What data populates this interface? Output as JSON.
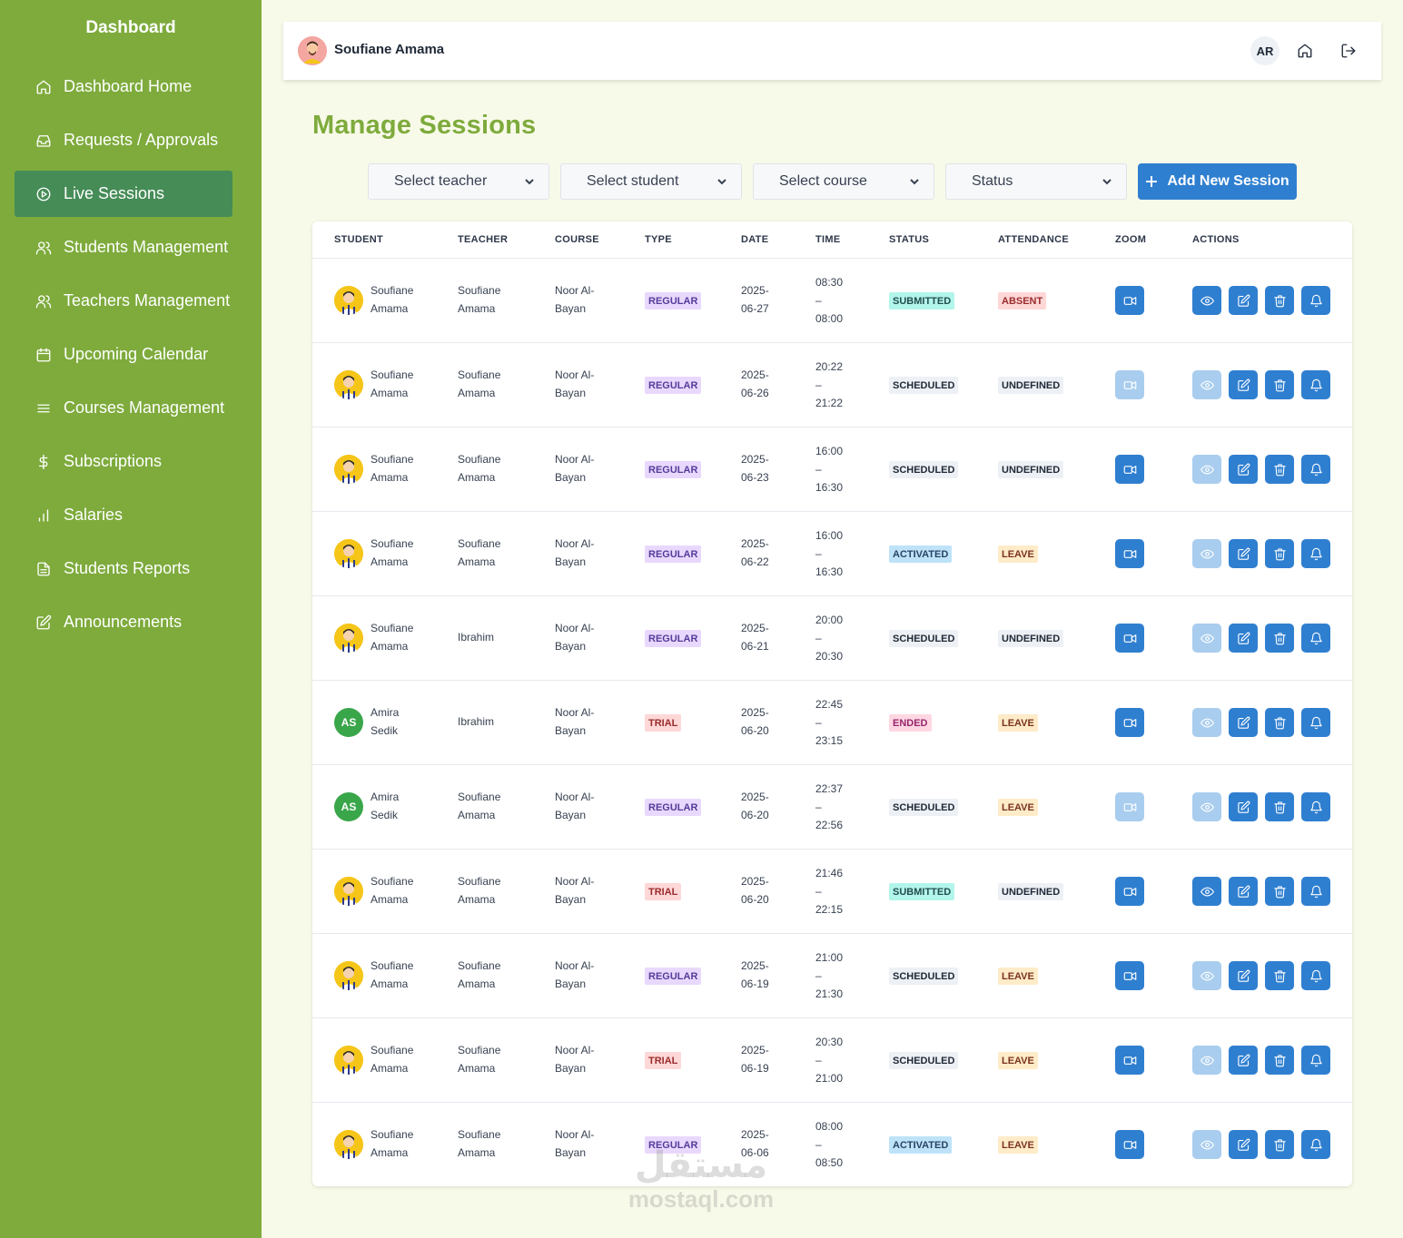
{
  "sidebar": {
    "title": "Dashboard",
    "items": [
      {
        "label": "Dashboard Home",
        "icon": "home-icon",
        "active": false
      },
      {
        "label": "Requests / Approvals",
        "icon": "inbox-icon",
        "active": false
      },
      {
        "label": "Live Sessions",
        "icon": "play-circle-icon",
        "active": true
      },
      {
        "label": "Students Management",
        "icon": "users-icon",
        "active": false
      },
      {
        "label": "Teachers Management",
        "icon": "users-icon",
        "active": false
      },
      {
        "label": "Upcoming Calendar",
        "icon": "calendar-icon",
        "active": false
      },
      {
        "label": "Courses Management",
        "icon": "list-icon",
        "active": false
      },
      {
        "label": "Subscriptions",
        "icon": "dollar-icon",
        "active": false
      },
      {
        "label": "Salaries",
        "icon": "bar-chart-icon",
        "active": false
      },
      {
        "label": "Students Reports",
        "icon": "file-text-icon",
        "active": false
      },
      {
        "label": "Announcements",
        "icon": "edit-icon",
        "active": false
      }
    ]
  },
  "header": {
    "user_name": "Soufiane Amama",
    "language": "AR",
    "home_icon": "home-icon",
    "logout_icon": "logout-icon"
  },
  "page": {
    "title": "Manage Sessions"
  },
  "filters": {
    "teacher": "Select teacher",
    "student": "Select student",
    "course": "Select course",
    "status": "Status",
    "add_button": "Add New Session"
  },
  "table": {
    "columns": [
      "STUDENT",
      "TEACHER",
      "COURSE",
      "TYPE",
      "DATE",
      "TIME",
      "STATUS",
      "ATTENDANCE",
      "ZOOM",
      "ACTIONS"
    ],
    "rows": [
      {
        "avatar": "pic",
        "initials": "",
        "student": [
          "Soufiane",
          "Amama"
        ],
        "teacher": [
          "Soufiane",
          "Amama"
        ],
        "course": [
          "Noor Al-",
          "Bayan"
        ],
        "type": "REGULAR",
        "date": [
          "2025-",
          "06-27"
        ],
        "time": [
          "08:30",
          "–",
          "08:00"
        ],
        "status": "SUBMITTED",
        "attendance": "ABSENT",
        "zoom_enabled": true,
        "view_enabled": true
      },
      {
        "avatar": "pic",
        "initials": "",
        "student": [
          "Soufiane",
          "Amama"
        ],
        "teacher": [
          "Soufiane",
          "Amama"
        ],
        "course": [
          "Noor Al-",
          "Bayan"
        ],
        "type": "REGULAR",
        "date": [
          "2025-",
          "06-26"
        ],
        "time": [
          "20:22",
          "–",
          "21:22"
        ],
        "status": "SCHEDULED",
        "attendance": "UNDEFINED",
        "zoom_enabled": false,
        "view_enabled": false
      },
      {
        "avatar": "pic",
        "initials": "",
        "student": [
          "Soufiane",
          "Amama"
        ],
        "teacher": [
          "Soufiane",
          "Amama"
        ],
        "course": [
          "Noor Al-",
          "Bayan"
        ],
        "type": "REGULAR",
        "date": [
          "2025-",
          "06-23"
        ],
        "time": [
          "16:00",
          "–",
          "16:30"
        ],
        "status": "SCHEDULED",
        "attendance": "UNDEFINED",
        "zoom_enabled": true,
        "view_enabled": false
      },
      {
        "avatar": "pic",
        "initials": "",
        "student": [
          "Soufiane",
          "Amama"
        ],
        "teacher": [
          "Soufiane",
          "Amama"
        ],
        "course": [
          "Noor Al-",
          "Bayan"
        ],
        "type": "REGULAR",
        "date": [
          "2025-",
          "06-22"
        ],
        "time": [
          "16:00",
          "–",
          "16:30"
        ],
        "status": "ACTIVATED",
        "attendance": "LEAVE",
        "zoom_enabled": true,
        "view_enabled": false
      },
      {
        "avatar": "pic",
        "initials": "",
        "student": [
          "Soufiane",
          "Amama"
        ],
        "teacher": [
          "Ibrahim",
          ""
        ],
        "course": [
          "Noor Al-",
          "Bayan"
        ],
        "type": "REGULAR",
        "date": [
          "2025-",
          "06-21"
        ],
        "time": [
          "20:00",
          "–",
          "20:30"
        ],
        "status": "SCHEDULED",
        "attendance": "UNDEFINED",
        "zoom_enabled": true,
        "view_enabled": false
      },
      {
        "avatar": "init",
        "initials": "AS",
        "student": [
          "Amira",
          "Sedik"
        ],
        "teacher": [
          "Ibrahim",
          ""
        ],
        "course": [
          "Noor Al-",
          "Bayan"
        ],
        "type": "TRIAL",
        "date": [
          "2025-",
          "06-20"
        ],
        "time": [
          "22:45",
          "–",
          "23:15"
        ],
        "status": "ENDED",
        "attendance": "LEAVE",
        "zoom_enabled": true,
        "view_enabled": false
      },
      {
        "avatar": "init",
        "initials": "AS",
        "student": [
          "Amira",
          "Sedik"
        ],
        "teacher": [
          "Soufiane",
          "Amama"
        ],
        "course": [
          "Noor Al-",
          "Bayan"
        ],
        "type": "REGULAR",
        "date": [
          "2025-",
          "06-20"
        ],
        "time": [
          "22:37",
          "–",
          "22:56"
        ],
        "status": "SCHEDULED",
        "attendance": "LEAVE",
        "zoom_enabled": false,
        "view_enabled": false
      },
      {
        "avatar": "pic",
        "initials": "",
        "student": [
          "Soufiane",
          "Amama"
        ],
        "teacher": [
          "Soufiane",
          "Amama"
        ],
        "course": [
          "Noor Al-",
          "Bayan"
        ],
        "type": "TRIAL",
        "date": [
          "2025-",
          "06-20"
        ],
        "time": [
          "21:46",
          "–",
          "22:15"
        ],
        "status": "SUBMITTED",
        "attendance": "UNDEFINED",
        "zoom_enabled": true,
        "view_enabled": true
      },
      {
        "avatar": "pic",
        "initials": "",
        "student": [
          "Soufiane",
          "Amama"
        ],
        "teacher": [
          "Soufiane",
          "Amama"
        ],
        "course": [
          "Noor Al-",
          "Bayan"
        ],
        "type": "REGULAR",
        "date": [
          "2025-",
          "06-19"
        ],
        "time": [
          "21:00",
          "–",
          "21:30"
        ],
        "status": "SCHEDULED",
        "attendance": "LEAVE",
        "zoom_enabled": true,
        "view_enabled": false
      },
      {
        "avatar": "pic",
        "initials": "",
        "student": [
          "Soufiane",
          "Amama"
        ],
        "teacher": [
          "Soufiane",
          "Amama"
        ],
        "course": [
          "Noor Al-",
          "Bayan"
        ],
        "type": "TRIAL",
        "date": [
          "2025-",
          "06-19"
        ],
        "time": [
          "20:30",
          "–",
          "21:00"
        ],
        "status": "SCHEDULED",
        "attendance": "LEAVE",
        "zoom_enabled": true,
        "view_enabled": false
      },
      {
        "avatar": "pic",
        "initials": "",
        "student": [
          "Soufiane",
          "Amama"
        ],
        "teacher": [
          "Soufiane",
          "Amama"
        ],
        "course": [
          "Noor Al-",
          "Bayan"
        ],
        "type": "REGULAR",
        "date": [
          "2025-",
          "06-06"
        ],
        "time": [
          "08:00",
          "–",
          "08:50"
        ],
        "status": "ACTIVATED",
        "attendance": "LEAVE",
        "zoom_enabled": true,
        "view_enabled": false
      }
    ]
  },
  "watermark": {
    "arabic": "مستقل",
    "latin": "mostaql.com"
  },
  "colors": {
    "sidebar": "#7eab3c",
    "active_nav": "#468c57",
    "primary": "#2f7fd0",
    "title": "#7eab3c"
  }
}
